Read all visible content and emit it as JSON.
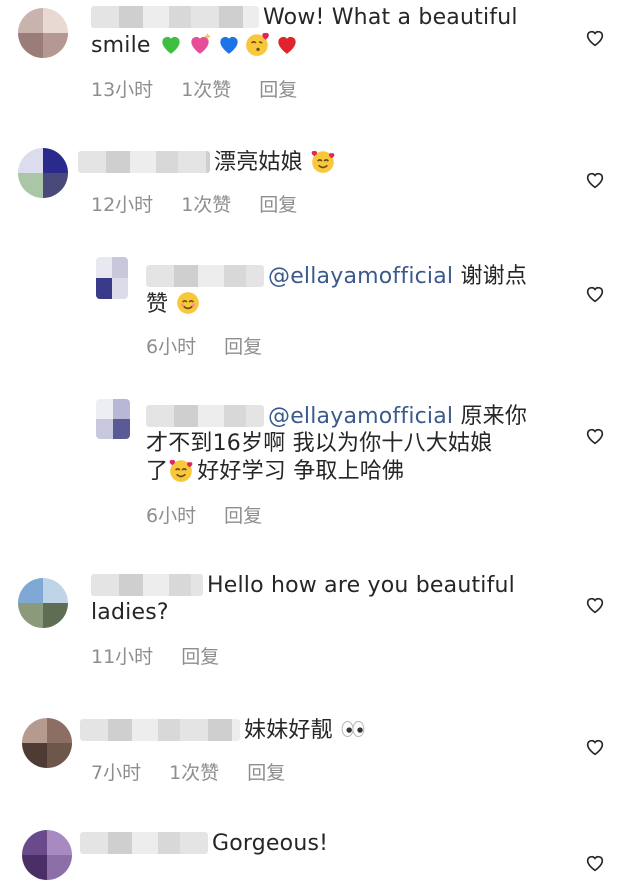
{
  "comments": [
    {
      "text": "Wow! What a beautiful",
      "text2": "smile",
      "emoji": [
        "green-heart",
        "sparkling-heart",
        "blue-heart",
        "kissing-face",
        "red-heart"
      ],
      "time": "13小时",
      "likes": "1次赞",
      "reply": "回复"
    },
    {
      "text": "漂亮姑娘",
      "emoji": [
        "smiling-face-with-hearts"
      ],
      "time": "12小时",
      "likes": "1次赞",
      "reply": "回复"
    },
    {
      "mention": "@ellayamofficial",
      "text": "谢谢点",
      "text2": "赞",
      "emoji": [
        "smiling-face"
      ],
      "time": "6小时",
      "reply": "回复"
    },
    {
      "mention": "@ellayamofficial",
      "text": "原来你",
      "text2": "才不到16岁啊 我以为你十八大姑娘",
      "text3a": "了",
      "text3b": "好好学习 争取上哈佛",
      "emoji": [
        "smiling-face-with-hearts"
      ],
      "time": "6小时",
      "reply": "回复"
    },
    {
      "text": "Hello how are you beautiful",
      "text2": "ladies?",
      "time": "11小时",
      "reply": "回复"
    },
    {
      "text": "妹妹好靓",
      "emoji": [
        "eyes"
      ],
      "time": "7小时",
      "likes": "1次赞",
      "reply": "回复"
    },
    {
      "text": "Gorgeous!"
    }
  ],
  "icons": {
    "like": "heart-outline-icon"
  },
  "colors": {
    "text": "#262626",
    "meta": "#8e8e8e",
    "mention": "#3b5a8c"
  }
}
